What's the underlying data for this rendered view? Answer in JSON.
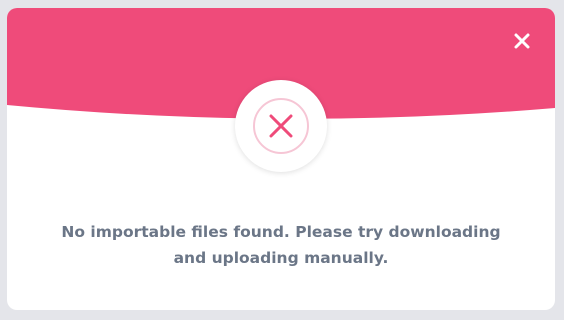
{
  "dialog": {
    "header_color": "#ef4b7a",
    "close_icon": "close-icon",
    "status_icon": "error-x-icon",
    "message": "No importable files found. Please try downloading and uploading manually."
  }
}
